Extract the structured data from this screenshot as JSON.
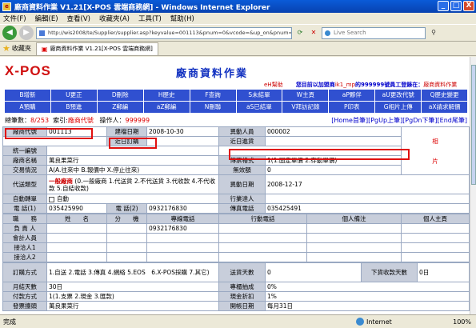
{
  "window": {
    "title": "廠商資料作業 V1.21[X-POS 雲端商務網] - Windows Internet Explorer",
    "minimize": "_",
    "maximize": "□",
    "close": "X"
  },
  "menu": [
    "文件(F)",
    "編輯(E)",
    "查看(V)",
    "收藏夾(A)",
    "工具(T)",
    "幫助(H)"
  ],
  "address": {
    "url": "http://wis2008/te/Supplier/supplier.asp?keyvalue=001113&pnum=0&vcode=&up_on&pnum=0&dnext=%",
    "search_placeholder": "Live Search"
  },
  "favorites": {
    "label": "收藏夾",
    "tab_label": "廠商資料作業 V1.21[X-POS 雲端商務網]"
  },
  "page": {
    "logo": "X-POS",
    "title": "廠商資料作業",
    "help_link": "eH幫助",
    "user_info_prefix": "您目前以加盟商",
    "user_info_id": "ik1_mp",
    "user_info_mid": "的999999號員工登錄在：",
    "user_info_store": "廠商資料作業"
  },
  "function_buttons": {
    "row1": [
      "B增新",
      "U更正",
      "D刪除",
      "H歷史",
      "F查詢",
      "S未結單",
      "W主頁",
      "aP夥伴",
      "aU更改代號",
      "Q歷史變更"
    ],
    "row2": [
      "A預購",
      "B預進",
      "Z郵編",
      "aZ郵編",
      "N刪聯",
      "aS已結單",
      "V拜訪記錄",
      "P印表",
      "G相片上傳",
      "aX請求解價"
    ]
  },
  "navline": {
    "record_label": "總筆數：",
    "record_value": "8/253",
    "index_label": "索引:",
    "index_value": "廠商代號",
    "operator_label": "操作人：",
    "operator_value": "999999",
    "nav_home": "[Home首筆]",
    "nav_pgup": "[PgUp上筆]",
    "nav_pgdn": "[PgDn下筆]",
    "nav_end": "[End尾筆]"
  },
  "form": {
    "vendor_code_label": "廠商代號",
    "vendor_code": "001113",
    "build_date_label": "建檔日期",
    "build_date": "2008-10-30",
    "change_person_label": "異動人員",
    "change_person": "000002",
    "recent_order_label": "近日訂購",
    "recent_purchase_label": "近日進貨",
    "unified_no_label": "統一編號",
    "name_label": "廠商名稱",
    "name": "萬良果菜行",
    "doc_format_label": "傳票格式",
    "doc_format": "1(1.固定單價 2.存動單價)",
    "photo_char1": "相",
    "photo_char2": "片",
    "trade_status_label": "交易情況",
    "trade_status": "A(A.往來中 B.報價中 X.停止往來)",
    "invalid_label": "無效額",
    "invalid_value": "0",
    "tax_type_label": "代送類型",
    "tax_type_value": "一般廠商",
    "tax_type_options": "(0.一般廠商 1.代送貨 2.不代送貨 3.代收款 4.不代收款 5.自結收款)",
    "change_date_label": "異動日期",
    "change_date": "2008-12-17",
    "auto_transfer_label": "自動轉單",
    "auto_transfer_value": "自動",
    "industry_label": "行業達人",
    "phone1_label": "電 話(1)",
    "phone1": "035425990",
    "phone2_label": "電 話(2)",
    "phone2": "0932176830",
    "fax_label": "傳真電話",
    "fax": "035425491"
  },
  "contacts": {
    "headers": [
      "職　　務",
      "姓　　名",
      "分　　機",
      "專線電話",
      "行動電話",
      "個人備注",
      "個人主頁"
    ],
    "rows": [
      {
        "role": "負 責 人",
        "line": "0932176830"
      },
      {
        "role": "會計人員",
        "line": ""
      },
      {
        "role": "接洽人1",
        "line": ""
      },
      {
        "role": "接洽人2",
        "line": ""
      }
    ]
  },
  "bottom": {
    "order_method_label": "訂購方式",
    "order_method": "1.自送 2.電話 3.傳真 4.網絡 5.EOS　6.X-POS採購 7.其它)",
    "delivery_days_label": "送貨天數",
    "delivery_days": "0",
    "collection_days_label": "下貨收款天數",
    "collection_days": "0日",
    "monthly_days_label": "月結天數",
    "monthly_days": "30日",
    "commission_label": "專櫃抽成",
    "commission": "0%",
    "payment_label": "付款方式",
    "payment": "1(1.支票 2.現金 3.匯款)",
    "cash_discount_label": "現金折扣",
    "cash_discount": "1%",
    "invoice_label": "發票擡頭",
    "invoice": "萬良果菜行",
    "invoice_date_label": "開帳日期",
    "invoice_date": "每月31日"
  },
  "status": {
    "done": "完成",
    "zone": "Internet",
    "zoom": "100%"
  }
}
